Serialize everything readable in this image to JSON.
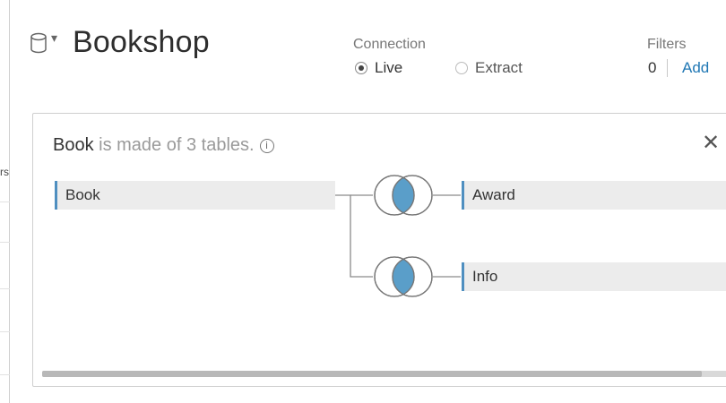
{
  "datasource": {
    "title": "Bookshop",
    "icon": "database-icon",
    "caret": "▾"
  },
  "connection": {
    "label": "Connection",
    "options": [
      {
        "label": "Live",
        "selected": true
      },
      {
        "label": "Extract",
        "selected": false
      }
    ]
  },
  "filters": {
    "label": "Filters",
    "count": "0",
    "add_label": "Add"
  },
  "left_panel": {
    "fragment": "rs"
  },
  "card": {
    "title_table": "Book",
    "title_rest": " is made of 3 tables.",
    "info_icon": "info-icon",
    "close_symbol": "✕",
    "tables": [
      {
        "name": "Book"
      },
      {
        "name": "Award"
      },
      {
        "name": "Info"
      }
    ],
    "join_type": "inner",
    "scrollbar": {
      "position_fraction": 0.0,
      "visible_fraction": 0.96
    }
  },
  "colors": {
    "accent": "#4f8fc0",
    "join_fill": "#5a9ec9",
    "link": "#1f77b4"
  }
}
